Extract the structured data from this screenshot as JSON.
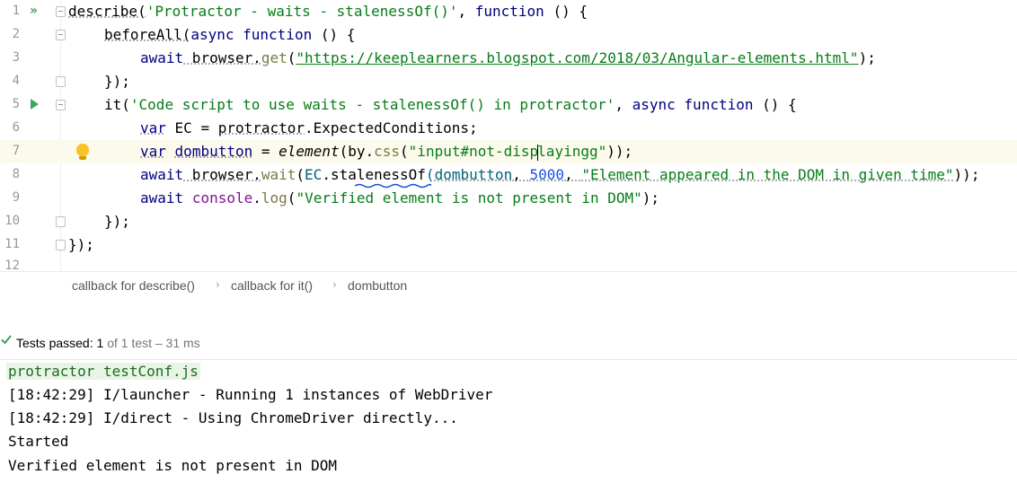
{
  "editor": {
    "line_numbers": [
      "1",
      "2",
      "3",
      "4",
      "5",
      "6",
      "7",
      "8",
      "9",
      "10",
      "11",
      "12"
    ],
    "lines": {
      "l1": {
        "a": "describe(",
        "b": "'Protractor - waits - stalenessOf()'",
        "c": ", ",
        "d": "function",
        "e": " () {"
      },
      "l2": {
        "a": "beforeAll(",
        "b": "async",
        "c": " ",
        "d": "function",
        "e": " () {"
      },
      "l3": {
        "a": "await",
        "b": " browser.",
        "c": "get",
        "d": "(",
        "e": "\"https://keeplearners.blogspot.com/2018/03/Angular-elements.html\"",
        "f": ");"
      },
      "l4": {
        "a": "});"
      },
      "l5": {
        "a": "it(",
        "b": "'Code script to use waits - stalenessOf() in protractor'",
        "c": ", ",
        "d": "async",
        "e": " ",
        "f": "function",
        "g": " () {"
      },
      "l6": {
        "a": "var",
        "b": " EC = ",
        "c": "protractor",
        "d": ".ExpectedConditions;"
      },
      "l7": {
        "a": "var",
        "b": " ",
        "c": "dombutton",
        "d": " = ",
        "e": "element",
        "f": "(by.",
        "g": "css",
        "h": "(",
        "i": "\"input#not-disp",
        "j": "layingg\"",
        "k": "));"
      },
      "l8": {
        "a": "await",
        "b": " browser.",
        "c": "wait",
        "d": "(",
        "e": "EC",
        "f": ".",
        "g": "stalenessOf",
        "h": "(",
        "i": "dombutton",
        "j": ", ",
        "k": "5000",
        "l": ", ",
        "m": "\"Element appeared in the DOM in given time\"",
        "n": "));"
      },
      "l9": {
        "a": "await",
        "b": " ",
        "c": "console",
        "d": ".",
        "e": "log",
        "f": "(",
        "g": "\"Verified element is not present in DOM\"",
        "h": ");"
      },
      "l10": {
        "a": "});"
      },
      "l11": {
        "a": "});"
      }
    }
  },
  "breadcrumb": {
    "items": [
      "callback for describe()",
      "callback for it()",
      "dombutton"
    ],
    "separator": "›"
  },
  "test_status": {
    "label": "Tests passed:",
    "count": "1",
    "detail": "of 1 test – 31 ms"
  },
  "console": {
    "lines": [
      "protractor testConf.js",
      "[18:42:29] I/launcher - Running 1 instances of WebDriver",
      "[18:42:29] I/direct - Using ChromeDriver directly...",
      "Started",
      "Verified element is not present in DOM"
    ]
  },
  "colors": {
    "keyword": "#000080",
    "string": "#067d17",
    "current_line": "#fcfaed",
    "run_icon": "#3ba55d"
  },
  "icons": [
    "run-all-icon",
    "run-icon",
    "fold-icon",
    "intention-bulb-icon",
    "check-icon"
  ]
}
